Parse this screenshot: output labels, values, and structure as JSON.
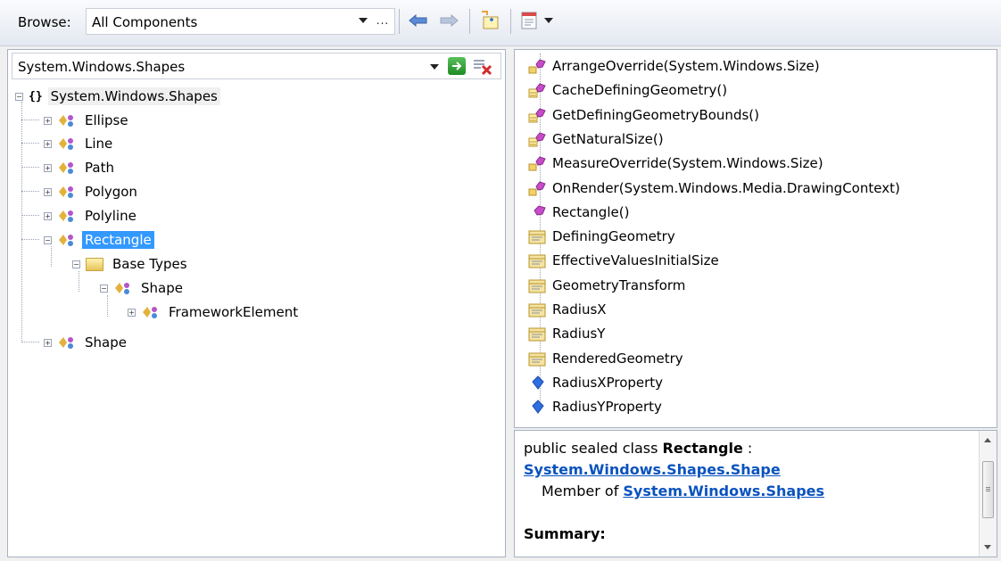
{
  "toolbar": {
    "browse_label": "Browse:",
    "browse_value": "All Components",
    "ellipsis": "..."
  },
  "search": {
    "value": "System.Windows.Shapes"
  },
  "tree": {
    "namespace": "System.Windows.Shapes",
    "items": {
      "ellipse": "Ellipse",
      "line": "Line",
      "path": "Path",
      "polygon": "Polygon",
      "polyline": "Polyline",
      "rectangle": "Rectangle",
      "base_types": "Base Types",
      "base_shape": "Shape",
      "framework_element": "FrameworkElement",
      "shape": "Shape"
    }
  },
  "members": [
    {
      "label": "ArrangeOverride(System.Windows.Size)",
      "kind": "protected-method"
    },
    {
      "label": "CacheDefiningGeometry()",
      "kind": "internal-method"
    },
    {
      "label": "GetDefiningGeometryBounds()",
      "kind": "internal-method"
    },
    {
      "label": "GetNaturalSize()",
      "kind": "internal-method"
    },
    {
      "label": "MeasureOverride(System.Windows.Size)",
      "kind": "protected-method"
    },
    {
      "label": "OnRender(System.Windows.Media.DrawingContext)",
      "kind": "protected-method"
    },
    {
      "label": "Rectangle()",
      "kind": "public-method"
    },
    {
      "label": "DefiningGeometry",
      "kind": "property"
    },
    {
      "label": "EffectiveValuesInitialSize",
      "kind": "property"
    },
    {
      "label": "GeometryTransform",
      "kind": "property"
    },
    {
      "label": "RadiusX",
      "kind": "property"
    },
    {
      "label": "RadiusY",
      "kind": "property"
    },
    {
      "label": "RenderedGeometry",
      "kind": "property"
    },
    {
      "label": "RadiusXProperty",
      "kind": "field"
    },
    {
      "label": "RadiusYProperty",
      "kind": "field"
    }
  ],
  "description": {
    "prefix": "public sealed class ",
    "class_name": "Rectangle",
    "colon": " :",
    "base_link": "System.Windows.Shapes.Shape",
    "member_of": "Member of ",
    "namespace_link": "System.Windows.Shapes",
    "summary": "Summary:"
  },
  "colors": {
    "selection": "#3399ff",
    "link": "#0a53be",
    "method_icon": "#c64cc8",
    "field_icon": "#2f6ee0",
    "property_icon": "#d8b446"
  }
}
